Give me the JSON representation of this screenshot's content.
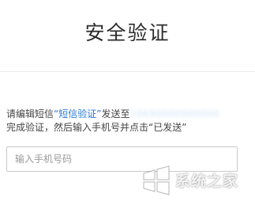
{
  "header": {
    "title": "安全验证"
  },
  "instruction": {
    "part1": "请编辑短信",
    "quote_open": "“",
    "sms_keyword": "短信验证",
    "quote_close": "”",
    "part2": "发送至",
    "phone_masked": "10690000000000",
    "part3": "完成验证，然后输入手机号并点击",
    "sent_label": "“已发送”"
  },
  "phone_input": {
    "placeholder": "输入手机号码",
    "value": ""
  },
  "watermark": {
    "text": "系统之家",
    "icon": "windows-logo-icon"
  },
  "colors": {
    "accent": "#2a78d4",
    "border": "#c9c9c9"
  }
}
